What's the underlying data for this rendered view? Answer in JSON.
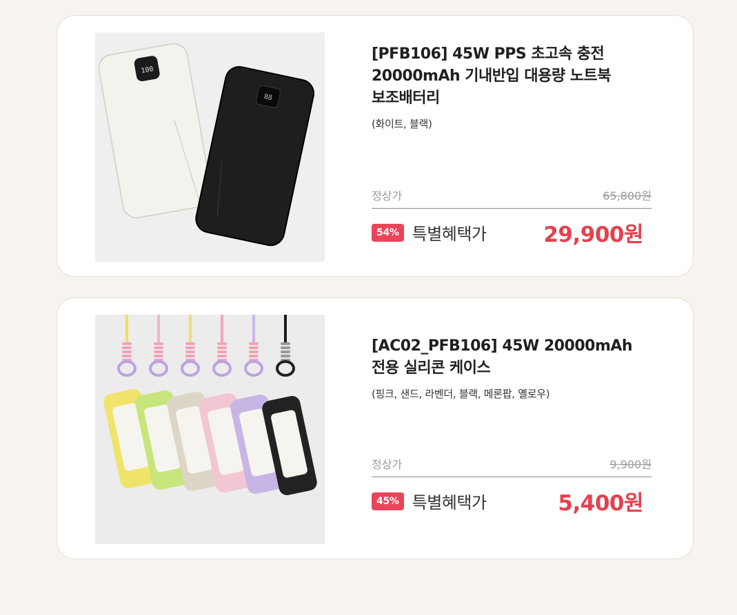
{
  "products": [
    {
      "title": "[PFB106] 45W PPS 초고속 충전\n20000mAh 기내반입 대용량 노트북\n보조배터리",
      "options": "(화이트, 블랙)",
      "regular_label": "정상가",
      "regular_price": "65,800원",
      "discount_badge": "54%",
      "sale_label": "특별혜택가",
      "sale_price": "29,900원",
      "image_alt": "white and black power banks",
      "colors": [
        "#f3f1ec",
        "#1c1c1c"
      ]
    },
    {
      "title": "[AC02_PFB106] 45W 20000mAh\n전용 실리콘 케이스",
      "options": "(핑크, 샌드, 라벤더, 블랙, 메론팝, 옐로우)",
      "regular_label": "정상가",
      "regular_price": "9,900원",
      "discount_badge": "45%",
      "sale_label": "특별혜택가",
      "sale_price": "5,400원",
      "image_alt": "silicone cases in six colors",
      "case_colors": [
        "#f0e36a",
        "#c6e57a",
        "#ddd6c6",
        "#f2c6d2",
        "#c7b5e6",
        "#222222"
      ]
    }
  ],
  "colors": {
    "accent": "#e4414e",
    "badge": "#e94559",
    "background": "#f7f4ef"
  }
}
